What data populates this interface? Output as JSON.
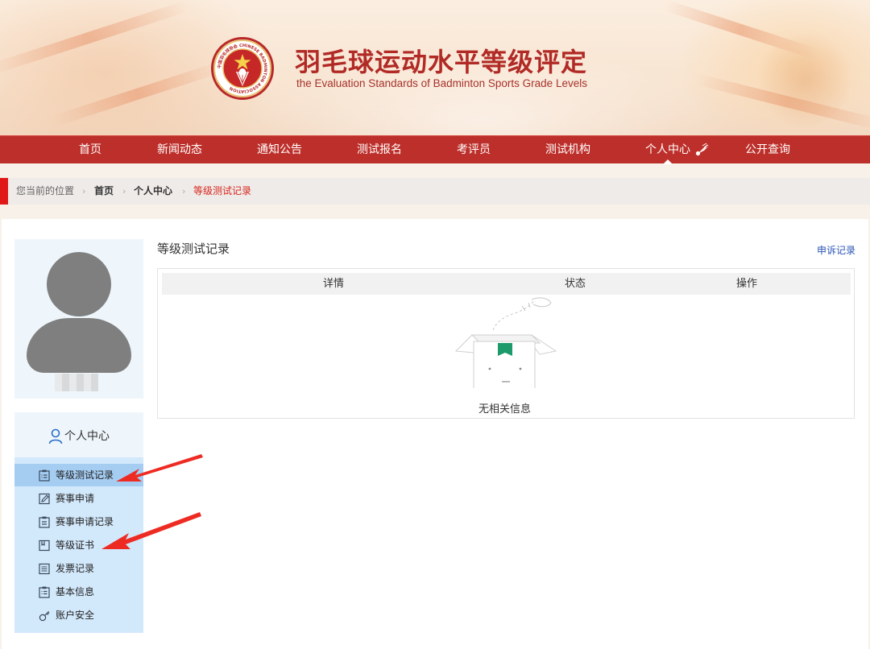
{
  "header": {
    "title_cn": "羽毛球运动水平等级评定",
    "title_en": "the Evaluation Standards of Badminton Sports Grade Levels",
    "logo_text": "中国羽毛球协会 CHINESE BADMINTON ASSOCIATION"
  },
  "nav": {
    "items": [
      {
        "label": "首页"
      },
      {
        "label": "新闻动态"
      },
      {
        "label": "通知公告"
      },
      {
        "label": "测试报名"
      },
      {
        "label": "考评员"
      },
      {
        "label": "测试机构"
      },
      {
        "label": "个人中心"
      },
      {
        "label": "公开查询"
      }
    ],
    "active_index": 6
  },
  "breadcrumb": {
    "label": "您当前的位置",
    "items": [
      "首页",
      "个人中心",
      "等级测试记录"
    ]
  },
  "sidebar": {
    "section_title": "个人中心",
    "items": [
      {
        "label": "等级测试记录",
        "icon": "clipboard-list-icon",
        "active": true
      },
      {
        "label": "赛事申请",
        "icon": "pencil-edit-icon",
        "active": false
      },
      {
        "label": "赛事申请记录",
        "icon": "clipboard-icon",
        "active": false
      },
      {
        "label": "等级证书",
        "icon": "certificate-icon",
        "active": false
      },
      {
        "label": "发票记录",
        "icon": "invoice-icon",
        "active": false
      },
      {
        "label": "基本信息",
        "icon": "info-list-icon",
        "active": false
      },
      {
        "label": "账户安全",
        "icon": "key-icon",
        "active": false
      }
    ]
  },
  "main": {
    "title": "等级测试记录",
    "appeal_link": "申诉记录",
    "table": {
      "columns": [
        "详情",
        "状态",
        "操作"
      ],
      "rows": [],
      "empty_text": "无相关信息"
    }
  },
  "colors": {
    "brand_red": "#bd2f2a",
    "breadcrumb_accent": "#e01818",
    "sidebar_bg": "#d2e8fb",
    "sidebar_active": "#a5cdf2",
    "link_blue": "#2a55b5",
    "annotation_arrow": "#ee2b23"
  }
}
